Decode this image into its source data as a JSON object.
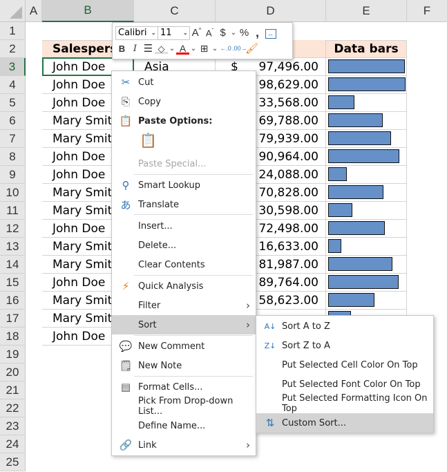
{
  "columns": [
    "A",
    "B",
    "C",
    "D",
    "E",
    "F"
  ],
  "selected_column": "B",
  "rows": [
    "1",
    "2",
    "3",
    "4",
    "5",
    "6",
    "7",
    "8",
    "9",
    "10",
    "11",
    "12",
    "13",
    "14",
    "15",
    "16",
    "17",
    "18",
    "19",
    "20",
    "21",
    "22",
    "23",
    "24",
    "25"
  ],
  "selected_row": "3",
  "table": {
    "headers": {
      "salesperson": "Salesperso",
      "data_bars": "Data bars"
    },
    "currency_symbol": "$",
    "first_region": "Asia",
    "records": [
      {
        "row": "3",
        "name": "John Doe",
        "amount": "97,496.00",
        "value": 97496
      },
      {
        "row": "4",
        "name": "John Doe",
        "amount": "98,629.00",
        "value": 98629
      },
      {
        "row": "5",
        "name": "John Doe",
        "amount": "33,568.00",
        "value": 33568
      },
      {
        "row": "6",
        "name": "Mary Smith",
        "amount": "69,788.00",
        "value": 69788
      },
      {
        "row": "7",
        "name": "Mary Smith",
        "amount": "79,939.00",
        "value": 79939
      },
      {
        "row": "8",
        "name": "John Doe",
        "amount": "90,964.00",
        "value": 90964
      },
      {
        "row": "9",
        "name": "John Doe",
        "amount": "24,088.00",
        "value": 24088
      },
      {
        "row": "10",
        "name": "Mary Smith",
        "amount": "70,828.00",
        "value": 70828
      },
      {
        "row": "11",
        "name": "Mary Smith",
        "amount": "30,598.00",
        "value": 30598
      },
      {
        "row": "12",
        "name": "John Doe",
        "amount": "72,498.00",
        "value": 72498
      },
      {
        "row": "13",
        "name": "Mary Smith",
        "amount": "16,633.00",
        "value": 16633
      },
      {
        "row": "14",
        "name": "Mary Smith",
        "amount": "81,987.00",
        "value": 81987
      },
      {
        "row": "15",
        "name": "John Doe",
        "amount": "89,764.00",
        "value": 89764
      },
      {
        "row": "16",
        "name": "Mary Smith",
        "amount": "58,623.00",
        "value": 58623
      },
      {
        "row": "17",
        "name": "Mary Smith",
        "amount": "",
        "value": 29000
      },
      {
        "row": "18",
        "name": "John Doe",
        "amount": "",
        "value": null
      }
    ],
    "bar_color": "#6690c8"
  },
  "mini_toolbar": {
    "font_name": "Calibri",
    "font_size": "11",
    "icons": [
      "increase-font-size",
      "decrease-font-size",
      "accounting-format",
      "percent-style",
      "comma-style",
      "merge-center",
      "bold",
      "italic",
      "align-center",
      "fill-color",
      "font-color",
      "borders",
      "increase-decimal",
      "decrease-decimal",
      "format-painter"
    ]
  },
  "context_menu": {
    "items": [
      {
        "label": "Cut",
        "icon": "scissors"
      },
      {
        "label": "Copy",
        "icon": "copy"
      },
      {
        "label": "Paste Options:",
        "icon": "paste"
      },
      {
        "label": "Paste Special...",
        "disabled": true
      },
      {
        "label": "Smart Lookup",
        "icon": "smart-lookup"
      },
      {
        "label": "Translate",
        "icon": "translate"
      },
      {
        "label": "Insert..."
      },
      {
        "label": "Delete..."
      },
      {
        "label": "Clear Contents"
      },
      {
        "label": "Quick Analysis",
        "icon": "quick-analysis"
      },
      {
        "label": "Filter",
        "submenu": true
      },
      {
        "label": "Sort",
        "submenu": true,
        "highlighted": true
      },
      {
        "label": "New Comment",
        "icon": "new-comment"
      },
      {
        "label": "New Note",
        "icon": "new-note"
      },
      {
        "label": "Format Cells...",
        "icon": "format-cells"
      },
      {
        "label": "Pick From Drop-down List..."
      },
      {
        "label": "Define Name..."
      },
      {
        "label": "Link",
        "icon": "link",
        "submenu": true
      }
    ]
  },
  "sort_submenu": {
    "items": [
      {
        "label": "Sort A to Z",
        "icon": "sort-a-z"
      },
      {
        "label": "Sort Z to A",
        "icon": "sort-z-a"
      },
      {
        "label": "Put Selected Cell Color On Top"
      },
      {
        "label": "Put Selected Font Color On Top"
      },
      {
        "label": "Put Selected Formatting Icon On Top"
      },
      {
        "label": "Custom Sort...",
        "icon": "custom-sort",
        "highlighted": true
      }
    ]
  }
}
